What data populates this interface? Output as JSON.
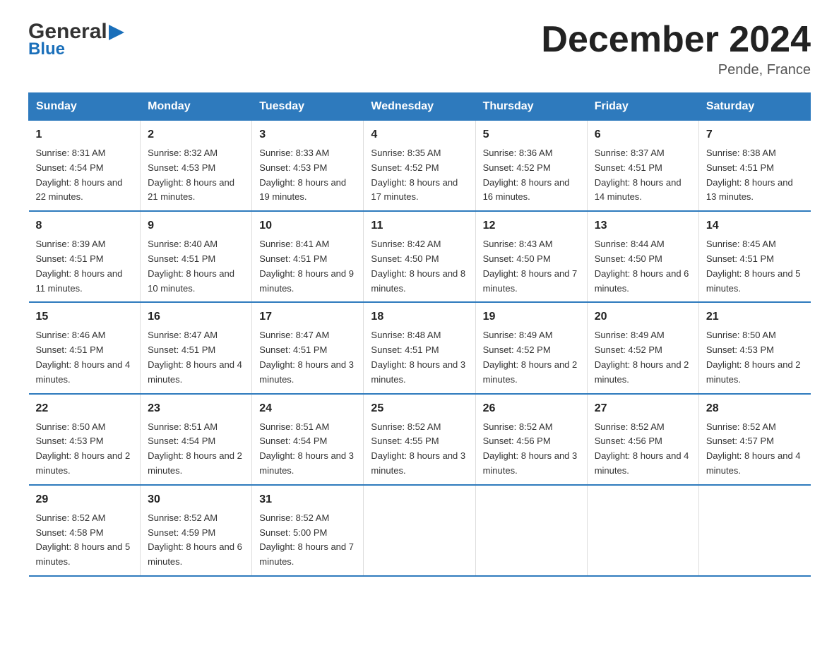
{
  "logo": {
    "general": "General",
    "blue": "Blue"
  },
  "title": "December 2024",
  "location": "Pende, France",
  "days_of_week": [
    "Sunday",
    "Monday",
    "Tuesday",
    "Wednesday",
    "Thursday",
    "Friday",
    "Saturday"
  ],
  "weeks": [
    [
      {
        "day": "1",
        "sunrise": "8:31 AM",
        "sunset": "4:54 PM",
        "daylight": "8 hours and 22 minutes."
      },
      {
        "day": "2",
        "sunrise": "8:32 AM",
        "sunset": "4:53 PM",
        "daylight": "8 hours and 21 minutes."
      },
      {
        "day": "3",
        "sunrise": "8:33 AM",
        "sunset": "4:53 PM",
        "daylight": "8 hours and 19 minutes."
      },
      {
        "day": "4",
        "sunrise": "8:35 AM",
        "sunset": "4:52 PM",
        "daylight": "8 hours and 17 minutes."
      },
      {
        "day": "5",
        "sunrise": "8:36 AM",
        "sunset": "4:52 PM",
        "daylight": "8 hours and 16 minutes."
      },
      {
        "day": "6",
        "sunrise": "8:37 AM",
        "sunset": "4:51 PM",
        "daylight": "8 hours and 14 minutes."
      },
      {
        "day": "7",
        "sunrise": "8:38 AM",
        "sunset": "4:51 PM",
        "daylight": "8 hours and 13 minutes."
      }
    ],
    [
      {
        "day": "8",
        "sunrise": "8:39 AM",
        "sunset": "4:51 PM",
        "daylight": "8 hours and 11 minutes."
      },
      {
        "day": "9",
        "sunrise": "8:40 AM",
        "sunset": "4:51 PM",
        "daylight": "8 hours and 10 minutes."
      },
      {
        "day": "10",
        "sunrise": "8:41 AM",
        "sunset": "4:51 PM",
        "daylight": "8 hours and 9 minutes."
      },
      {
        "day": "11",
        "sunrise": "8:42 AM",
        "sunset": "4:50 PM",
        "daylight": "8 hours and 8 minutes."
      },
      {
        "day": "12",
        "sunrise": "8:43 AM",
        "sunset": "4:50 PM",
        "daylight": "8 hours and 7 minutes."
      },
      {
        "day": "13",
        "sunrise": "8:44 AM",
        "sunset": "4:50 PM",
        "daylight": "8 hours and 6 minutes."
      },
      {
        "day": "14",
        "sunrise": "8:45 AM",
        "sunset": "4:51 PM",
        "daylight": "8 hours and 5 minutes."
      }
    ],
    [
      {
        "day": "15",
        "sunrise": "8:46 AM",
        "sunset": "4:51 PM",
        "daylight": "8 hours and 4 minutes."
      },
      {
        "day": "16",
        "sunrise": "8:47 AM",
        "sunset": "4:51 PM",
        "daylight": "8 hours and 4 minutes."
      },
      {
        "day": "17",
        "sunrise": "8:47 AM",
        "sunset": "4:51 PM",
        "daylight": "8 hours and 3 minutes."
      },
      {
        "day": "18",
        "sunrise": "8:48 AM",
        "sunset": "4:51 PM",
        "daylight": "8 hours and 3 minutes."
      },
      {
        "day": "19",
        "sunrise": "8:49 AM",
        "sunset": "4:52 PM",
        "daylight": "8 hours and 2 minutes."
      },
      {
        "day": "20",
        "sunrise": "8:49 AM",
        "sunset": "4:52 PM",
        "daylight": "8 hours and 2 minutes."
      },
      {
        "day": "21",
        "sunrise": "8:50 AM",
        "sunset": "4:53 PM",
        "daylight": "8 hours and 2 minutes."
      }
    ],
    [
      {
        "day": "22",
        "sunrise": "8:50 AM",
        "sunset": "4:53 PM",
        "daylight": "8 hours and 2 minutes."
      },
      {
        "day": "23",
        "sunrise": "8:51 AM",
        "sunset": "4:54 PM",
        "daylight": "8 hours and 2 minutes."
      },
      {
        "day": "24",
        "sunrise": "8:51 AM",
        "sunset": "4:54 PM",
        "daylight": "8 hours and 3 minutes."
      },
      {
        "day": "25",
        "sunrise": "8:52 AM",
        "sunset": "4:55 PM",
        "daylight": "8 hours and 3 minutes."
      },
      {
        "day": "26",
        "sunrise": "8:52 AM",
        "sunset": "4:56 PM",
        "daylight": "8 hours and 3 minutes."
      },
      {
        "day": "27",
        "sunrise": "8:52 AM",
        "sunset": "4:56 PM",
        "daylight": "8 hours and 4 minutes."
      },
      {
        "day": "28",
        "sunrise": "8:52 AM",
        "sunset": "4:57 PM",
        "daylight": "8 hours and 4 minutes."
      }
    ],
    [
      {
        "day": "29",
        "sunrise": "8:52 AM",
        "sunset": "4:58 PM",
        "daylight": "8 hours and 5 minutes."
      },
      {
        "day": "30",
        "sunrise": "8:52 AM",
        "sunset": "4:59 PM",
        "daylight": "8 hours and 6 minutes."
      },
      {
        "day": "31",
        "sunrise": "8:52 AM",
        "sunset": "5:00 PM",
        "daylight": "8 hours and 7 minutes."
      },
      null,
      null,
      null,
      null
    ]
  ]
}
